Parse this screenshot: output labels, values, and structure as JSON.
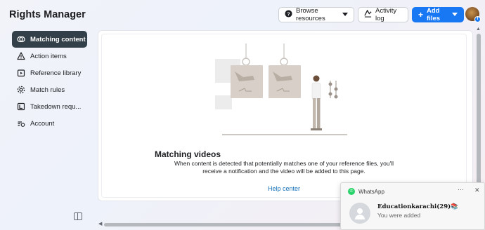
{
  "app": {
    "title": "Rights Manager"
  },
  "header": {
    "browse_label": "Browse resources",
    "activity_label": "Activity log",
    "add_label": "Add files"
  },
  "sidebar": {
    "items": [
      {
        "label": "Matching content",
        "icon": "matching-icon",
        "active": true
      },
      {
        "label": "Action items",
        "icon": "warning-icon",
        "active": false
      },
      {
        "label": "Reference library",
        "icon": "library-icon",
        "active": false
      },
      {
        "label": "Match rules",
        "icon": "gear-icon",
        "active": false
      },
      {
        "label": "Takedown requ...",
        "icon": "takedown-icon",
        "active": false
      },
      {
        "label": "Account",
        "icon": "account-icon",
        "active": false
      }
    ]
  },
  "main": {
    "empty_title": "Matching videos",
    "empty_desc": "When content is detected that potentially matches one of your reference files, you'll receive a notification and the video will be added to this page.",
    "help_link": "Help center"
  },
  "notification": {
    "app": "WhatsApp",
    "sender": "Educationkarachi(29)📚",
    "message": "You were added"
  },
  "colors": {
    "accent": "#1877f2",
    "active_nav": "#344049",
    "link": "#1470b8",
    "whatsapp": "#25d366"
  }
}
